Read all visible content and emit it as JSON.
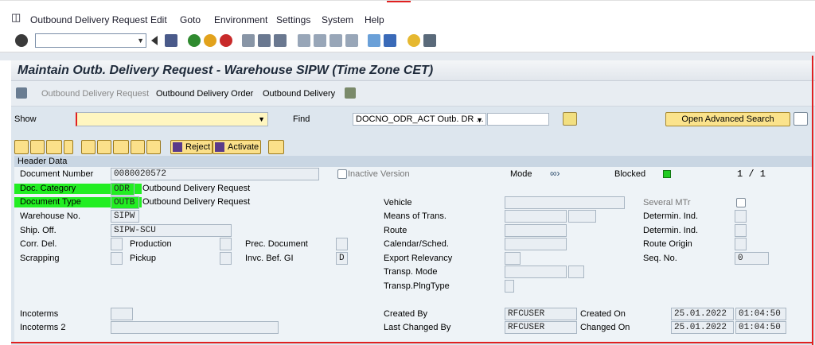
{
  "menu": {
    "items": [
      "Outbound Delivery Request",
      "Edit",
      "Goto",
      "Environment",
      "Settings",
      "System",
      "Help"
    ]
  },
  "title": "Maintain Outb. Delivery Request - Warehouse SIPW (Time Zone CET)",
  "appbar": {
    "items": [
      "Outbound Delivery Request",
      "Outbound Delivery Order",
      "Outbound Delivery"
    ]
  },
  "search": {
    "show_label": "Show",
    "find_label": "Find",
    "find_select": "DOCNO_ODR_ACT Outb. DR ...",
    "advanced_btn": "Open Advanced Search"
  },
  "actions": {
    "reject": "Reject",
    "activate": "Activate"
  },
  "header": {
    "title": "Header Data",
    "doc_number_label": "Document Number",
    "doc_number": "0080020572",
    "inactive_label": "Inactive Version",
    "mode_label": "Mode",
    "blocked_label": "Blocked",
    "page_indicator": "1 / 1",
    "doc_category_label": "Doc. Category",
    "doc_category": "ODR",
    "doc_category_text": "Outbound Delivery Request",
    "doc_type_label": "Document Type",
    "doc_type": "OUTB",
    "doc_type_text": "Outbound Delivery Request",
    "warehouse_label": "Warehouse No.",
    "warehouse": "SIPW",
    "ship_off_label": "Ship. Off.",
    "ship_off": "SIPW-SCU",
    "corr_del_label": "Corr. Del.",
    "production_label": "Production",
    "prec_doc_label": "Prec. Document",
    "scrapping_label": "Scrapping",
    "pickup_label": "Pickup",
    "invc_label": "Invc. Bef. GI",
    "invc_value": "D",
    "vehicle_label": "Vehicle",
    "means_label": "Means of Trans.",
    "route_label": "Route",
    "calendar_label": "Calendar/Sched.",
    "export_label": "Export Relevancy",
    "transp_mode_label": "Transp. Mode",
    "transp_plng_label": "Transp.PlngType",
    "several_mtr_label": "Several MTr",
    "determ_ind_label": "Determin. Ind.",
    "route_origin_label": "Route Origin",
    "seq_no_label": "Seq. No.",
    "seq_no": "0",
    "incoterms_label": "Incoterms",
    "incoterms2_label": "Incoterms 2",
    "created_by_label": "Created By",
    "created_by": "RFCUSER",
    "created_on_label": "Created On",
    "created_on_date": "25.01.2022",
    "created_on_time": "01:04:50",
    "changed_by_label": "Last Changed By",
    "changed_by": "RFCUSER",
    "changed_on_label": "Changed On",
    "changed_on_date": "25.01.2022",
    "changed_on_time": "01:04:50"
  }
}
